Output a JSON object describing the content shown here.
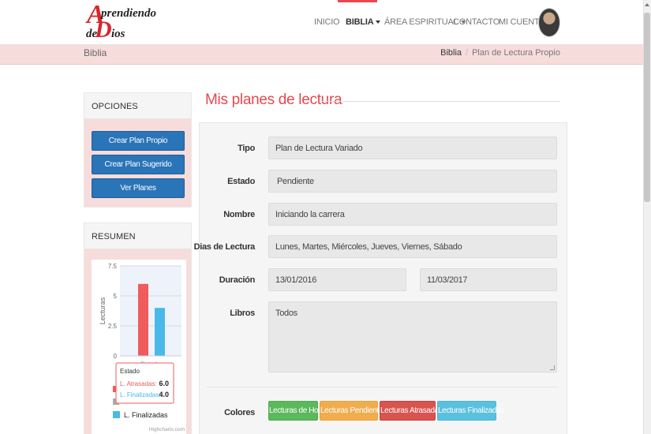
{
  "brand": {
    "logo_big_a": "A",
    "logo_word1": "prendiendo",
    "logo_small_de": "de",
    "logo_big_d": "D",
    "logo_word2": "ios"
  },
  "nav": {
    "items": [
      {
        "label": "INICIO"
      },
      {
        "label": "BIBLIA"
      },
      {
        "label": "ÁREA ESPIRITUAL"
      },
      {
        "label": "CONTACTO"
      },
      {
        "label": "MI CUENTA"
      }
    ],
    "active": "BIBLIA"
  },
  "breadcrumb": {
    "section": "Biblia",
    "trail": [
      "Biblia",
      "Plan de Lectura Propio"
    ],
    "separator": "/"
  },
  "sidebar": {
    "opciones_title": "OPCIONES",
    "buttons": [
      "Crear Plan Propio",
      "Crear Plan Sugerido",
      "Ver Planes"
    ],
    "resumen_title": "RESUMEN"
  },
  "chart_data": {
    "type": "bar",
    "categories": [
      "Estado"
    ],
    "series": [
      {
        "name": "L. Atrasadas",
        "values": [
          6.0
        ],
        "color": "#f05b5b"
      },
      {
        "name": "L. Finalizadas",
        "values": [
          4.0
        ],
        "color": "#4ab8e8"
      }
    ],
    "ylabel": "Lecturas",
    "ylim": [
      0,
      7.5
    ],
    "yticks": [
      "7.5",
      "5",
      "2.5",
      "0"
    ],
    "grid": true,
    "tooltip": {
      "title": "Estado",
      "rows": [
        {
          "label": "L. Atrasadas:",
          "value": "6.0"
        },
        {
          "label": "L. Finalizadas:",
          "value": "4.0"
        }
      ]
    },
    "legend_visible": "L. Finalizadas",
    "credit": "Highcharts.com"
  },
  "main": {
    "title": "Mis planes de lectura",
    "fields": {
      "tipo": {
        "label": "Tipo",
        "value": "Plan de Lectura Variado"
      },
      "estado": {
        "label": "Estado",
        "value": "Pendiente"
      },
      "nombre": {
        "label": "Nombre",
        "value": "Iniciando la carrera"
      },
      "dias": {
        "label": "Dias de Lectura",
        "value": "Lunes, Martes, Miércoles, Jueves, Viernes, Sábado"
      },
      "duracion": {
        "label": "Duración",
        "start": "13/01/2016",
        "end": "11/03/2017"
      },
      "libros": {
        "label": "Libros",
        "value": "Todos"
      }
    },
    "colores": {
      "label": "Colores",
      "buttons": [
        {
          "label": "Lecturas de Hoy",
          "color": "#5cb85c"
        },
        {
          "label": "Lecturas Pendientes",
          "color": "#f0ad4e"
        },
        {
          "label": "Lecturas Atrasadas",
          "color": "#d9534f"
        },
        {
          "label": "Lecturas Finalizadas",
          "color": "#5bc0de"
        }
      ]
    }
  }
}
